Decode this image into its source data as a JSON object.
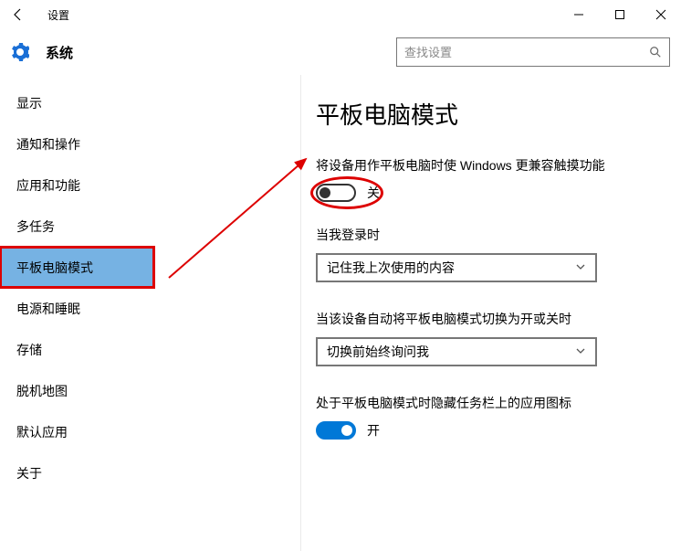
{
  "app_title": "设置",
  "header": {
    "title": "系统",
    "search_placeholder": "查找设置"
  },
  "sidebar": {
    "items": [
      {
        "label": "显示"
      },
      {
        "label": "通知和操作"
      },
      {
        "label": "应用和功能"
      },
      {
        "label": "多任务"
      },
      {
        "label": "平板电脑模式"
      },
      {
        "label": "电源和睡眠"
      },
      {
        "label": "存储"
      },
      {
        "label": "脱机地图"
      },
      {
        "label": "默认应用"
      },
      {
        "label": "关于"
      }
    ],
    "selected_index": 4
  },
  "main": {
    "page_title": "平板电脑模式",
    "toggle1": {
      "label": "将设备用作平板电脑时使 Windows 更兼容触摸功能",
      "state_label": "关",
      "on": false
    },
    "signin": {
      "label": "当我登录时",
      "value": "记住我上次使用的内容"
    },
    "auto_switch": {
      "label": "当该设备自动将平板电脑模式切换为开或关时",
      "value": "切换前始终询问我"
    },
    "hide_icons": {
      "label": "处于平板电脑模式时隐藏任务栏上的应用图标",
      "state_label": "开",
      "on": true
    }
  }
}
